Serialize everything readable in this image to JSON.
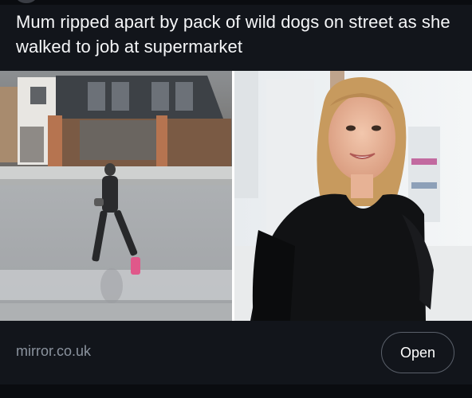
{
  "post": {
    "headline": "Mum ripped apart by pack of wild dogs on street as she walked to job at supermarket"
  },
  "media": {
    "left_image_icon": "cctv-street-photo",
    "right_image_icon": "portrait-photo"
  },
  "link": {
    "domain": "mirror.co.uk",
    "open_label": "Open"
  },
  "colors": {
    "background": "#12151b",
    "muted_text": "#8b939e",
    "button_border": "#5a606a"
  }
}
